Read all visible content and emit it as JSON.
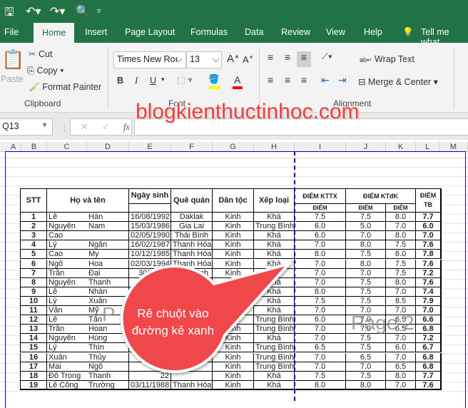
{
  "qat": {
    "icons": [
      "save-icon",
      "undo-icon",
      "redo-icon",
      "print-preview-icon",
      "customize-icon"
    ]
  },
  "tabs": [
    "File",
    "Home",
    "Insert",
    "Page Layout",
    "Formulas",
    "Data",
    "Review",
    "View",
    "Help"
  ],
  "tell_me": "Tell me what",
  "clipboard": {
    "paste": "Paste",
    "cut": "Cut",
    "copy": "Copy",
    "format_painter": "Format Painter",
    "group": "Clipboard"
  },
  "font": {
    "name": "Times New Roı",
    "size": "13",
    "bold": "B",
    "italic": "I",
    "underline": "U",
    "group": "Font",
    "fill_color": "#ffff00",
    "font_color": "#ff0000"
  },
  "alignment": {
    "wrap": "Wrap Text",
    "merge": "Merge & Center",
    "group": "Alignment"
  },
  "namebox": "Q13",
  "fx": "fx",
  "watermark_blog": "blogkienthuctinhoc.com",
  "columns": [
    "A",
    "B",
    "C",
    "D",
    "E",
    "F",
    "G",
    "H",
    "I",
    "J",
    "K",
    "L",
    "M"
  ],
  "table": {
    "headers": {
      "stt": "STT",
      "name": "Họ và tên",
      "dob": "Ngày sinh",
      "home": "Quê quán",
      "ethnic": "Dân tộc",
      "rank": "Xếp loại",
      "kttx": "ĐIỂM KTTX",
      "ktdk": "ĐIỂM KTđK",
      "tb": "ĐIỂM TB",
      "sub1": "ĐIỂM",
      "sub2": "ĐIỂM",
      "sub3": "ĐIỂM"
    },
    "rows": [
      [
        "1",
        "Lê",
        "Hán",
        "16/08/1992",
        "Daklak",
        "Kinh",
        "Khá",
        "7.5",
        "7.5",
        "8.0",
        "7.7"
      ],
      [
        "2",
        "Nguyễn",
        "Nam",
        "15/03/1986",
        "Gia Lai",
        "Kinh",
        "Trung Bình",
        "6.0",
        "5.0",
        "7.0",
        "6.0"
      ],
      [
        "3",
        "Cao",
        "",
        "02/05/1990",
        "Thái Bình",
        "Kinh",
        "Khá",
        "6.0",
        "7.0",
        "8.0",
        "7.0"
      ],
      [
        "4",
        "Lý",
        "Ngân",
        "16/02/1987",
        "Thanh Hóa",
        "Kinh",
        "Khá",
        "7.0",
        "8.0",
        "7.5",
        "7.6"
      ],
      [
        "5",
        "Cao",
        "My",
        "10/12/1985",
        "Thanh Hóa",
        "Kinh",
        "Khá",
        "8.0",
        "7.5",
        "8.0",
        "7.8"
      ],
      [
        "6",
        "Ngô",
        "Hoa",
        "02/03/1994",
        "Thanh Hóa",
        "Kinh",
        "Khá",
        "7.0",
        "8.0",
        "7.5",
        "7.6"
      ],
      [
        "7",
        "Trần",
        "Đại",
        "30/03/19",
        "Thái Bình",
        "Kinh",
        "Khá",
        "7.0",
        "7.0",
        "7.5",
        "7.2"
      ],
      [
        "8",
        "Nguyễn",
        "Thanh",
        "",
        "",
        "",
        "Khá",
        "7.0",
        "7.5",
        "8.0",
        "7.6"
      ],
      [
        "9",
        "Lê",
        "Nhàn",
        "",
        "",
        "",
        "Khá",
        "8.0",
        "7.5",
        "7.0",
        "7.4"
      ],
      [
        "10",
        "Lý",
        "Xuân",
        "",
        "",
        "",
        "Khá",
        "7.5",
        "7.5",
        "8.5",
        "7.9"
      ],
      [
        "11",
        "Văn",
        "Mỹ",
        "",
        "",
        "",
        "Khá",
        "7.0",
        "7.0",
        "7.0",
        "7.0"
      ],
      [
        "12",
        "Lê",
        "Tấn",
        "",
        "",
        "Thái",
        "Trung Bình",
        "6.0",
        "7.0",
        "6.5",
        "6.6"
      ],
      [
        "13",
        "Trần",
        "Hoan",
        "",
        "",
        "Kinh",
        "Trung Bình",
        "7.0",
        "7.0",
        "6.5",
        "6.8"
      ],
      [
        "14",
        "Nguyễn",
        "Hùng",
        "",
        "",
        "Kinh",
        "Khá",
        "7.0",
        "7.5",
        "7.0",
        "7.2"
      ],
      [
        "15",
        "Lý",
        "Thìn",
        "",
        "",
        "Kinh",
        "Trung Bình",
        "6.5",
        "7.5",
        "6.0",
        "6.7"
      ],
      [
        "16",
        "Xuân",
        "Thủy",
        "",
        "",
        "Kinh",
        "Trung Bình",
        "7.0",
        "6.5",
        "7.0",
        "6.8"
      ],
      [
        "17",
        "Mai",
        "Ngô",
        "",
        "",
        "Kinh",
        "Trung Bình",
        "7.0",
        "7.0",
        "6.5",
        "6.8"
      ],
      [
        "18",
        "Đỗ Trọng",
        "Thanh",
        "22",
        "",
        "Kinh",
        "Khá",
        "7.5",
        "7.5",
        "8.0",
        "7.7"
      ],
      [
        "19",
        "Lê Công",
        "Trường",
        "03/11/1988",
        "Thanh Hóa",
        "Kinh",
        "Khá",
        "8.0",
        "8.0",
        "7.0",
        "7.6"
      ]
    ]
  },
  "page_watermarks": {
    "p1": "P",
    "p2": "Page 2"
  },
  "callout": {
    "text": "Rê chuột vào đường kẻ xanh",
    "color": "#f0474b"
  },
  "page_break_color": "#0000cc"
}
